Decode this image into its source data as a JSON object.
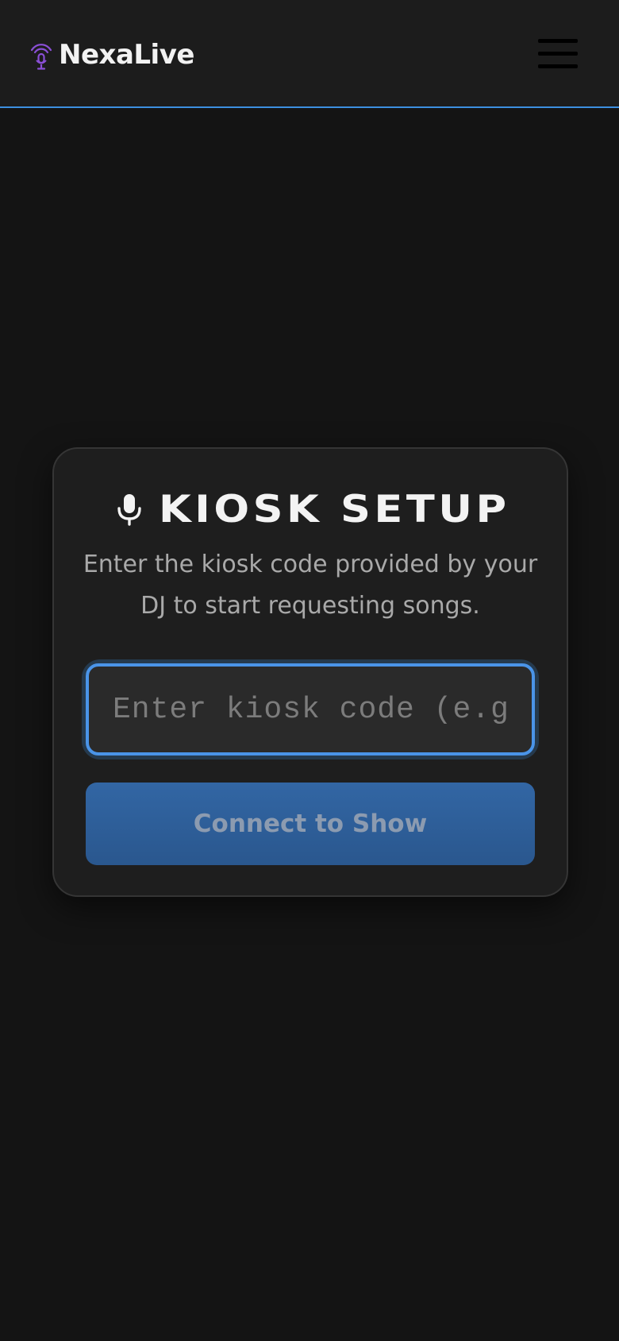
{
  "header": {
    "brand_name": "NexaLive",
    "brand_icon": "broadcast-mic-icon",
    "menu_icon": "hamburger-menu-icon",
    "accent_color": "#3d8fe0",
    "brand_icon_color": "#8a4fd6"
  },
  "kiosk": {
    "icon": "microphone-icon",
    "title": "KIOSK SETUP",
    "description": "Enter the kiosk code provided by your DJ to start requesting songs.",
    "input": {
      "value": "",
      "placeholder": "Enter kiosk code (e.g"
    },
    "connect_label": "Connect to Show",
    "button_color": "#2f5f98"
  }
}
